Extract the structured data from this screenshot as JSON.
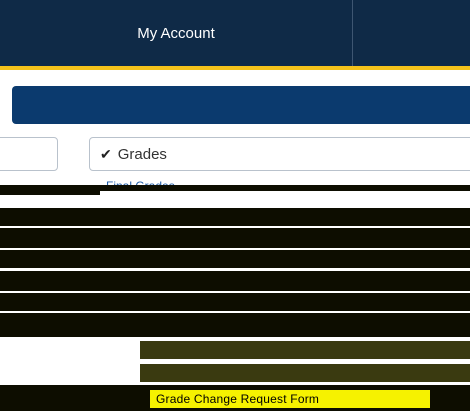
{
  "nav": {
    "tab_account": "My Account",
    "tab_next": ""
  },
  "grades_select": {
    "check_icon": "checkmark-icon",
    "label": "Grades"
  },
  "menu": {
    "item_final_grades": "Final Grades",
    "highlighted_item": "Grade Change Request Form"
  },
  "colors": {
    "nav_background": "#0f2a47",
    "accent_gold": "#f4c21b",
    "banner_blue": "#0b3a6e",
    "highlight_yellow": "#f6f200"
  }
}
